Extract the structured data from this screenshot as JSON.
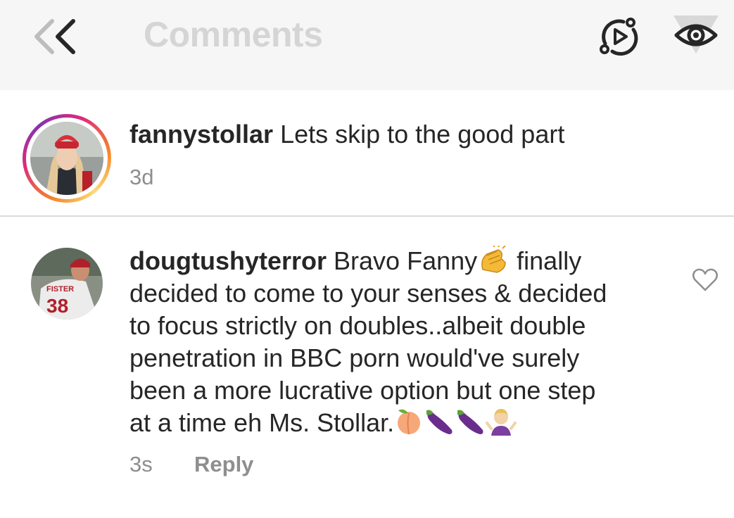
{
  "header": {
    "title": "Comments",
    "back_icon": "back-arrow-icon",
    "video_icon": "reels-play-icon",
    "eye_icon": "eye-icon"
  },
  "post": {
    "username": "fannystollar",
    "caption": "Lets skip to the good part",
    "age": "3d"
  },
  "comment": {
    "username": "dougtushyterror",
    "lines": [
      "Bravo Fanny",
      "finally",
      "decided to come to your senses & decided",
      "to focus strictly on doubles..albeit double",
      "penetration in BBC porn would've surely",
      "been a more lucrative option but one step",
      "at a time eh Ms. Stollar."
    ],
    "emojis": [
      "clapping-hands",
      "peach",
      "eggplant",
      "eggplant",
      "person-shrugging"
    ],
    "age": "3s",
    "reply_label": "Reply"
  },
  "colors": {
    "header_bg": "#f6f6f6",
    "muted": "#8e8e8e",
    "text": "#262626",
    "divider": "#dbdbdb"
  }
}
